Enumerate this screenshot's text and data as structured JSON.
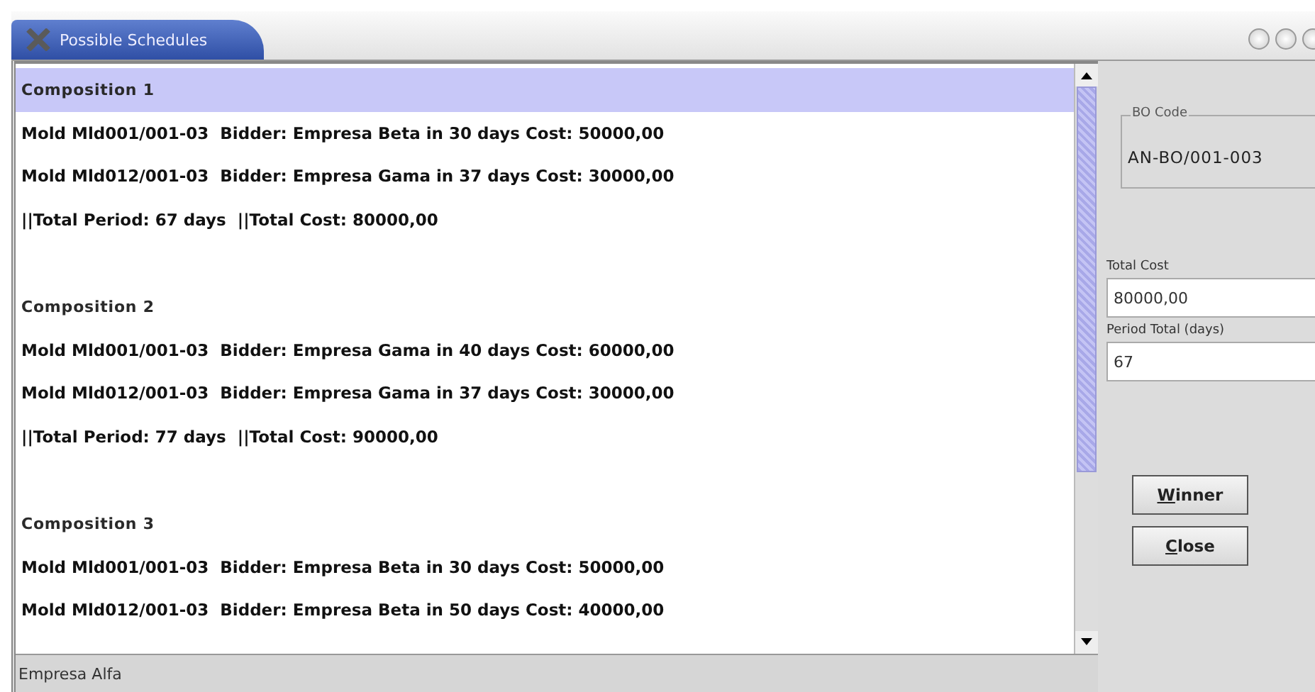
{
  "window": {
    "title": "Possible Schedules"
  },
  "list": {
    "items": [
      {
        "kind": "header",
        "text": "Composition 1",
        "selected": true
      },
      {
        "kind": "line",
        "text": "Mold Mld001/001-03  Bidder: Empresa Beta in 30 days Cost: 50000,00",
        "selected": false
      },
      {
        "kind": "line",
        "text": "Mold Mld012/001-03  Bidder: Empresa Gama in 37 days Cost: 30000,00",
        "selected": false
      },
      {
        "kind": "line",
        "text": "||Total Period: 67 days  ||Total Cost: 80000,00",
        "selected": false
      },
      {
        "kind": "blank",
        "selected": false
      },
      {
        "kind": "header",
        "text": "Composition 2",
        "selected": false
      },
      {
        "kind": "line",
        "text": "Mold Mld001/001-03  Bidder: Empresa Gama in 40 days Cost: 60000,00",
        "selected": false
      },
      {
        "kind": "line",
        "text": "Mold Mld012/001-03  Bidder: Empresa Gama in 37 days Cost: 30000,00",
        "selected": false
      },
      {
        "kind": "line",
        "text": "||Total Period: 77 days  ||Total Cost: 90000,00",
        "selected": false
      },
      {
        "kind": "blank",
        "selected": false
      },
      {
        "kind": "header",
        "text": "Composition 3",
        "selected": false
      },
      {
        "kind": "line",
        "text": "Mold Mld001/001-03  Bidder: Empresa Beta in 30 days Cost: 50000,00",
        "selected": false
      },
      {
        "kind": "line",
        "text": "Mold Mld012/001-03  Bidder: Empresa Beta in 50 days Cost: 40000,00",
        "selected": false
      }
    ]
  },
  "status_bar": {
    "text": "Empresa Alfa"
  },
  "side_panel": {
    "bo_code": {
      "label": "BO Code",
      "value": "AN-BO/001-003"
    },
    "fields": [
      {
        "label": "Total Cost",
        "value": "80000,00"
      },
      {
        "label": "Period Total (days)",
        "value": "67"
      }
    ],
    "buttons": [
      "Winner",
      "Close"
    ]
  }
}
